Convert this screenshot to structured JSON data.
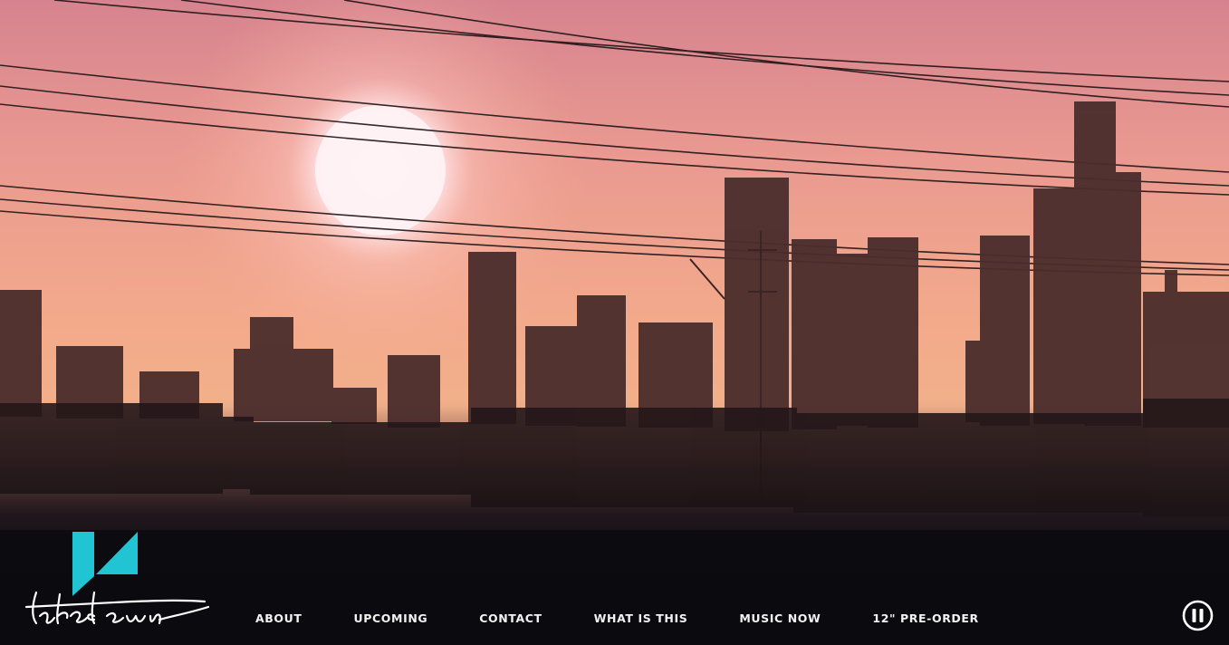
{
  "hero": {
    "scene": "city-skyline-sunset-video-background",
    "colors": {
      "sky_top": "#d9808a",
      "sky_mid": "#f0a38d",
      "horizon": "#f4b18b",
      "skyline": "#2a1a1e",
      "ground": "#0b0a0f",
      "sun": "#fff2f4"
    }
  },
  "logo": {
    "mark_icon": "logo-mark-icon",
    "mark_color": "#21c4d3",
    "wordmark": "takedown",
    "wordmark_color": "#ffffff"
  },
  "nav": {
    "items": [
      {
        "label": "ABOUT"
      },
      {
        "label": "UPCOMING"
      },
      {
        "label": "CONTACT"
      },
      {
        "label": "WHAT IS THIS"
      },
      {
        "label": "MUSIC NOW"
      },
      {
        "label": "12\" PRE-ORDER"
      }
    ],
    "text_color": "#f2f2f2"
  },
  "controls": {
    "pause_icon": "pause-icon",
    "pause_color": "#ffffff"
  }
}
